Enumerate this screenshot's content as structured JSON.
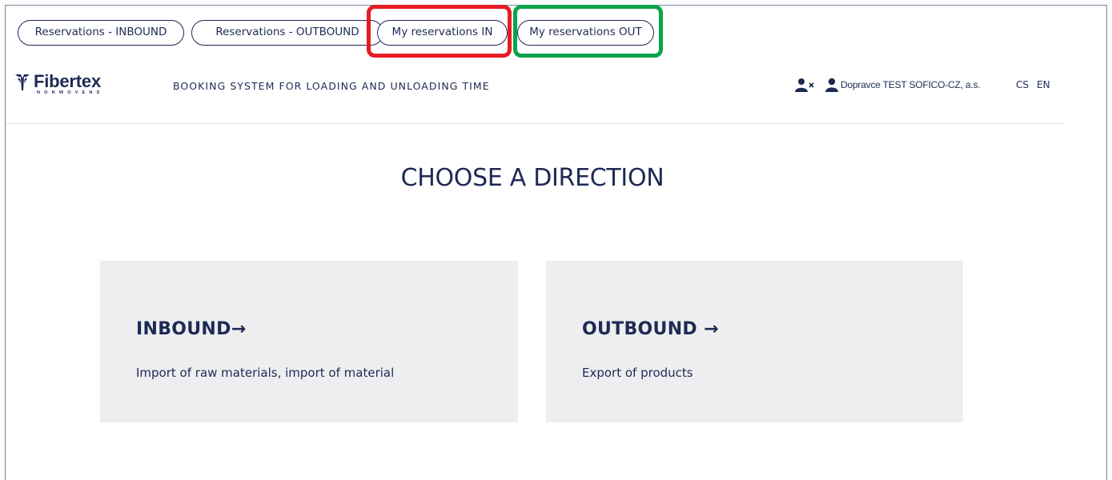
{
  "tabs": [
    {
      "label": "Reservations - INBOUND"
    },
    {
      "label": "Reservations - OUTBOUND"
    },
    {
      "label": "My reservations IN"
    },
    {
      "label": "My reservations OUT"
    }
  ],
  "highlight_colors": {
    "red": "#e61c24",
    "green": "#0ca44a"
  },
  "header": {
    "logo_text": "Fibertex",
    "logo_subtext": "NONWOVENS",
    "app_title": "BOOKING SYSTEM FOR LOADING AND UNLOADING TIME",
    "user_icons": [
      "user-remove-icon",
      "user-icon"
    ],
    "user_name": "Dopravce TEST SOFICO-CZ, a.s.",
    "languages": [
      "CS",
      "EN"
    ]
  },
  "main": {
    "heading": "CHOOSE A DIRECTION",
    "cards": [
      {
        "title": "INBOUND→",
        "description": "Import of raw materials, import of material"
      },
      {
        "title": "OUTBOUND →",
        "description": "Export of products"
      }
    ]
  },
  "colors": {
    "brand": "#1e2a55",
    "card_bg": "#eeeef0"
  }
}
